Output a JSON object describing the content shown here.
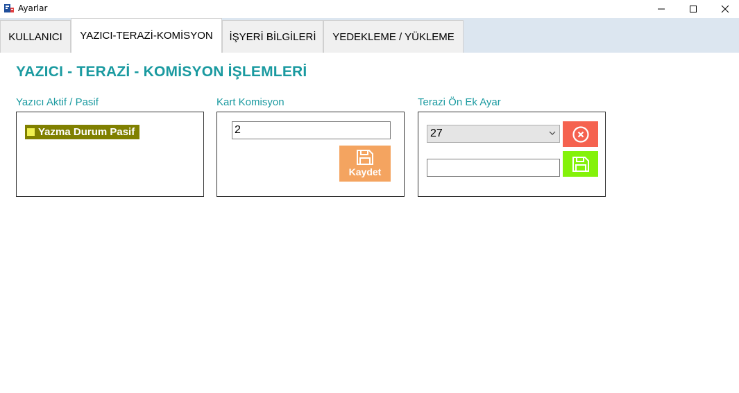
{
  "window": {
    "title": "Ayarlar",
    "controls": [
      "minimize-icon",
      "maximize-icon",
      "close-icon"
    ]
  },
  "tabs": [
    {
      "label": "KULLANICI",
      "active": false
    },
    {
      "label": "YAZICI-TERAZİ-KOMİSYON",
      "active": true
    },
    {
      "label": "İŞYERİ BİLGİLERİ",
      "active": false
    },
    {
      "label": "YEDEKLEME / YÜKLEME",
      "active": false
    }
  ],
  "page_title": "YAZICI - TERAZİ - KOMİSYON İŞLEMLERİ",
  "printer_group": {
    "label": "Yazıcı Aktif / Pasif",
    "status_label": "Yazma Durum Pasif"
  },
  "commission_group": {
    "label": "Kart Komisyon",
    "value": "2",
    "save_label": "Kaydet",
    "save_icon": "floppy-disk-icon"
  },
  "scale_group": {
    "label": "Terazi Ön Ek Ayar",
    "selected": "27",
    "input_value": "",
    "delete_icon": "cancel-circle-icon",
    "save_icon": "floppy-disk-icon"
  },
  "colors": {
    "accent": "#1a9aa0",
    "status_chip": "#808000",
    "save_orange": "#f4a460",
    "delete_red": "#f5624f",
    "save_green": "#84f20a"
  }
}
